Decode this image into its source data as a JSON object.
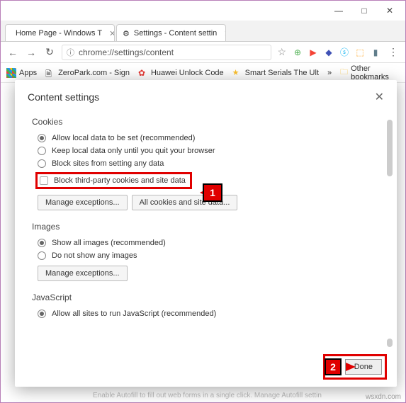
{
  "window": {
    "min": "—",
    "max": "□",
    "close": "✕"
  },
  "tabs": [
    {
      "icon": "ms",
      "title": "Home Page - Windows T"
    },
    {
      "icon": "gear",
      "title": "Settings - Content settin"
    }
  ],
  "nav": {
    "back": "←",
    "fwd": "→",
    "reload": "↻"
  },
  "address": {
    "info": "ⓘ",
    "url": "chrome://settings/content",
    "star": "☆"
  },
  "ext_icons": [
    "⊕",
    "▶",
    "◆",
    "ⓢ",
    "⬚",
    "▮"
  ],
  "menu": "⋮",
  "bookmarks": {
    "apps": "Apps",
    "items": [
      {
        "icon": "doc",
        "label": "ZeroPark.com - Sign"
      },
      {
        "icon": "huawei",
        "label": "Huawei Unlock Code"
      },
      {
        "icon": "star",
        "label": "Smart Serials The Ult"
      }
    ],
    "more": "»",
    "other": "Other bookmarks"
  },
  "dialog": {
    "title": "Content settings",
    "close": "✕",
    "cookies": {
      "heading": "Cookies",
      "opts": [
        "Allow local data to be set (recommended)",
        "Keep local data only until you quit your browser",
        "Block sites from setting any data"
      ],
      "chk": "Block third-party cookies and site data",
      "btn1": "Manage exceptions...",
      "btn2": "All cookies and site data..."
    },
    "images": {
      "heading": "Images",
      "opts": [
        "Show all images (recommended)",
        "Do not show any images"
      ],
      "btn": "Manage exceptions..."
    },
    "js": {
      "heading": "JavaScript",
      "opt": "Allow all sites to run JavaScript (recommended)"
    },
    "done": "Done"
  },
  "callouts": {
    "n1": "1",
    "n2": "2"
  },
  "grayed": "Enable Autofill to fill out web forms in a single click. Manage Autofill settin",
  "watermark": "wsxdn.com"
}
